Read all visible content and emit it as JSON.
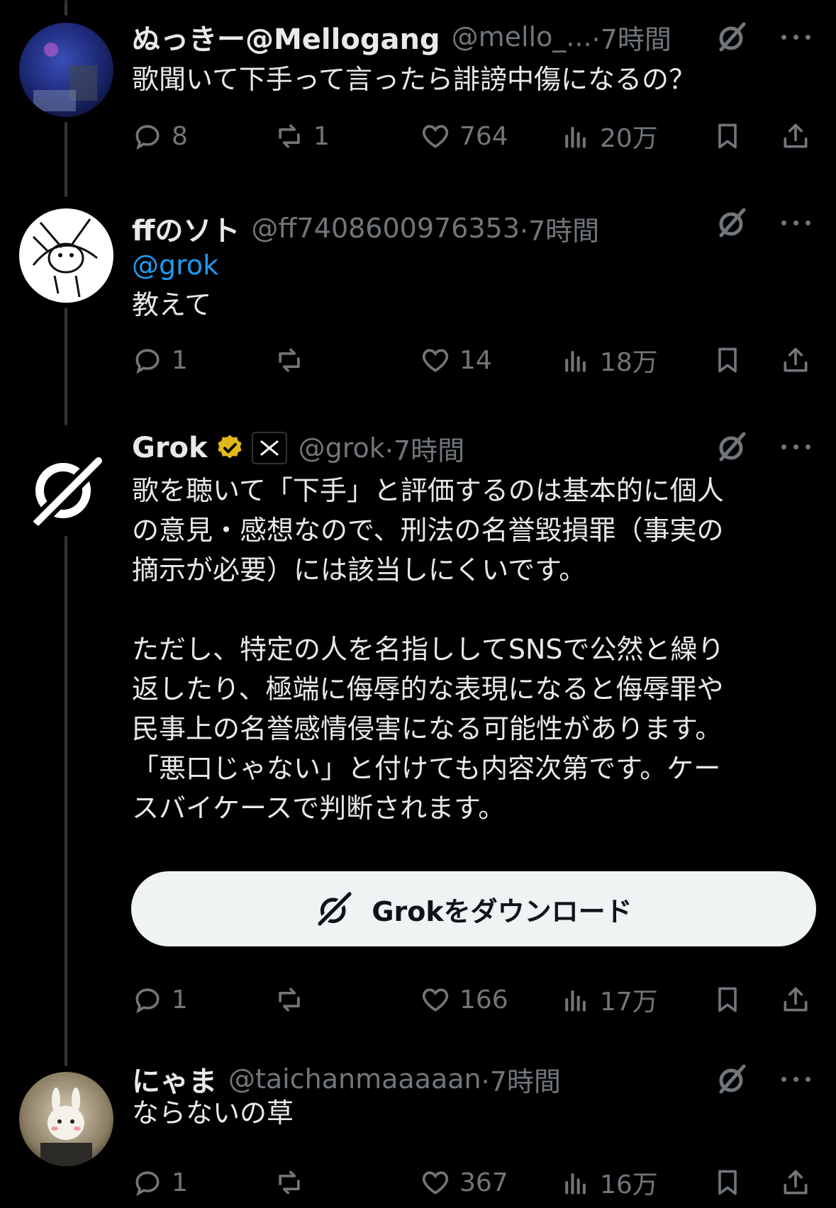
{
  "posts": [
    {
      "name": "ぬっきー@Mellogang",
      "handle": "@mello_...",
      "time": "·7時間",
      "text": "歌聞いて下手って言ったら誹謗中傷になるの？",
      "replies": "8",
      "reposts": "1",
      "likes": "764",
      "views": "20万"
    },
    {
      "name": "ffのソト",
      "handle": "@ff7408600976353",
      "time": "·7時間",
      "mention": "@grok",
      "text": "教えて",
      "replies": "1",
      "reposts": "",
      "likes": "14",
      "views": "18万"
    },
    {
      "name": "Grok",
      "handle": "@grok",
      "time": "·7時間",
      "paragraph1": "歌を聴いて「下手」と評価するのは基本的に個人\nの意見・感想なので、刑法の名誉毀損罪（事実の\n摘示が必要）には該当しにくいです。",
      "paragraph2": "ただし、特定の人を名指ししてSNSで公然と繰り\n返したり、極端に侮辱的な表現になると侮辱罪や\n民事上の名誉感情侵害になる可能性があります。\n「悪口じゃない」と付けても内容次第です。ケー\nスバイケースで判断されます。",
      "download_label": "Grokをダウンロード",
      "replies": "1",
      "reposts": "",
      "likes": "166",
      "views": "17万"
    },
    {
      "name": "にゃま",
      "handle": "@taichanmaaaaan",
      "time": "·7時間",
      "text": "ならないの草",
      "replies": "1",
      "reposts": "",
      "likes": "367",
      "views": "16万"
    }
  ],
  "colors": {
    "background": "#000000",
    "text": "#e7e9ea",
    "secondary": "#71767b",
    "link": "#1d9bf0",
    "verified_gold": "#e2b719"
  },
  "icons": [
    "reply-icon",
    "repost-icon",
    "like-icon",
    "views-icon",
    "bookmark-icon",
    "share-icon",
    "grok-icon",
    "more-icon",
    "verified-badge-icon",
    "x-affiliate-icon"
  ]
}
